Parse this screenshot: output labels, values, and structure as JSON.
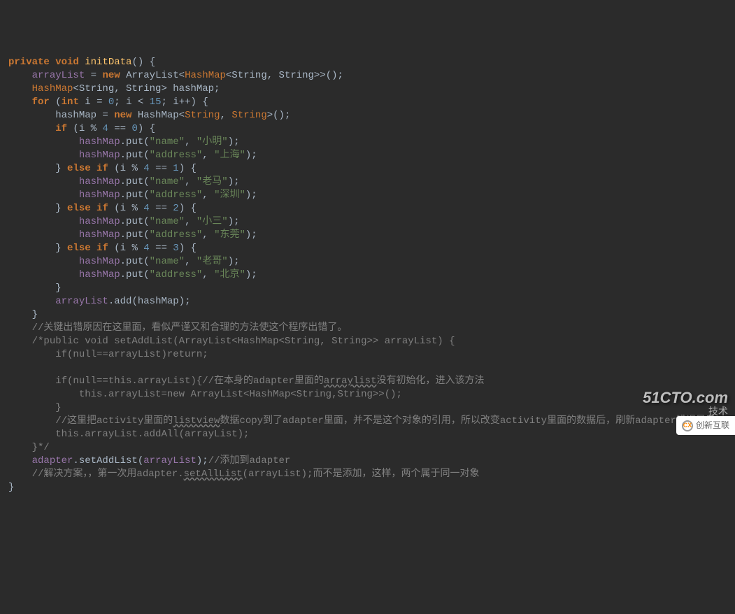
{
  "code": {
    "l1": {
      "kw_private": "private",
      "kw_void": "void",
      "method": "initData",
      "paren": "() {"
    },
    "l2": {
      "field": "arrayList",
      "op": " = ",
      "kw_new": "new",
      "cls": " ArrayList<",
      "type": "HashMap",
      "gen": "<String, String>",
      "close": ">();"
    },
    "l3": {
      "type": "HashMap",
      "gen": "<String, String> hashMap;"
    },
    "l4": {
      "kw_for": "for",
      "open": " (",
      "kw_int": "int",
      "var": " i = ",
      "n0": "0",
      "semi1": "; i < ",
      "n15": "15",
      "semi2": "; i++) {"
    },
    "l5": {
      "var": "hashMap = ",
      "kw_new": "new",
      "cls": " HashMap<",
      "t1": "String",
      "comma": ", ",
      "t2": "String",
      "close": ">();"
    },
    "l6": {
      "kw_if": "if",
      "open": " (i % ",
      "n4": "4",
      "eq": " == ",
      "n0": "0",
      "close": ") {"
    },
    "l7": {
      "obj": "hashMap",
      "method": ".put(",
      "s1": "\"name\"",
      "comma": ", ",
      "s2": "\"小明\"",
      "close": ");"
    },
    "l8": {
      "obj": "hashMap",
      "method": ".put(",
      "s1": "\"address\"",
      "comma": ", ",
      "s2": "\"上海\"",
      "close": ");"
    },
    "l9": {
      "close": "} ",
      "kw_else": "else",
      "kw_if": " if",
      "open": " (i % ",
      "n4": "4",
      "eq": " == ",
      "n1": "1",
      "close2": ") {"
    },
    "l10": {
      "obj": "hashMap",
      "method": ".put(",
      "s1": "\"name\"",
      "comma": ", ",
      "s2": "\"老马\"",
      "close": ");"
    },
    "l11": {
      "obj": "hashMap",
      "method": ".put(",
      "s1": "\"address\"",
      "comma": ", ",
      "s2": "\"深圳\"",
      "close": ");"
    },
    "l12": {
      "close": "} ",
      "kw_else": "else",
      "kw_if": " if",
      "open": " (i % ",
      "n4": "4",
      "eq": " == ",
      "n2": "2",
      "close2": ") {"
    },
    "l13": {
      "obj": "hashMap",
      "method": ".put(",
      "s1": "\"name\"",
      "comma": ", ",
      "s2": "\"小三\"",
      "close": ");"
    },
    "l14": {
      "obj": "hashMap",
      "method": ".put(",
      "s1": "\"address\"",
      "comma": ", ",
      "s2": "\"东莞\"",
      "close": ");"
    },
    "l15": {
      "close": "} ",
      "kw_else": "else",
      "kw_if": " if",
      "open": " (i % ",
      "n4": "4",
      "eq": " == ",
      "n3": "3",
      "close2": ") {"
    },
    "l16": {
      "obj": "hashMap",
      "method": ".put(",
      "s1": "\"name\"",
      "comma": ", ",
      "s2": "\"老哥\"",
      "close": ");"
    },
    "l17": {
      "obj": "hashMap",
      "method": ".put(",
      "s1": "\"address\"",
      "comma": ", ",
      "s2": "\"北京\"",
      "close": ");"
    },
    "l18": {
      "close": "}"
    },
    "l19": {
      "field": "arrayList",
      "method": ".add(",
      "var": "hashMap",
      "close": ");"
    },
    "l20": {
      "close": "}"
    },
    "l21": {
      "comment": "//关键出错原因在这里面，看似严谨又和合理的方法使这个程序出错了。"
    },
    "l22": {
      "comment": "/*public void setAddList(ArrayList<HashMap<String, String>> arrayList) {"
    },
    "l23": {
      "comment": "    if(null==arrayList)return;"
    },
    "l24": {
      "comment": ""
    },
    "l25": {
      "pre": "    if(null==this.arrayList){",
      "mid": "//在本身的adapter里面的",
      "ul": "arraylist",
      "post": "没有初始化，进入该方法"
    },
    "l26": {
      "comment": "        this.arrayList=new ArrayList<HashMap<String,String>>();"
    },
    "l27": {
      "comment": "    }"
    },
    "l28": {
      "pre": "    //这里把activity里面的",
      "ul": "listview",
      "mid": "数据copy到了adapter里面，并不是这个对象的引用，所以改变activity里面的数据后，刷新adapter错误显示"
    },
    "l29": {
      "comment": "    this.arrayList.addAll(arrayList);"
    },
    "l30": {
      "comment": "}*/"
    },
    "l31": {
      "field": "adapter",
      "method": ".setAddList(",
      "var": "arrayList",
      "close": ");",
      "comment": "//添加到adapter"
    },
    "l32": {
      "pre": "//解决方案，，第一次用adapter.",
      "ul": "setAllList",
      "mid": "(arrayList);而不是添加，这样，两个属于同一对象"
    },
    "l33": {
      "close": "}"
    }
  },
  "watermarks": {
    "w1": "51CTO.com",
    "w2": "技术",
    "w3": "创新互联"
  }
}
